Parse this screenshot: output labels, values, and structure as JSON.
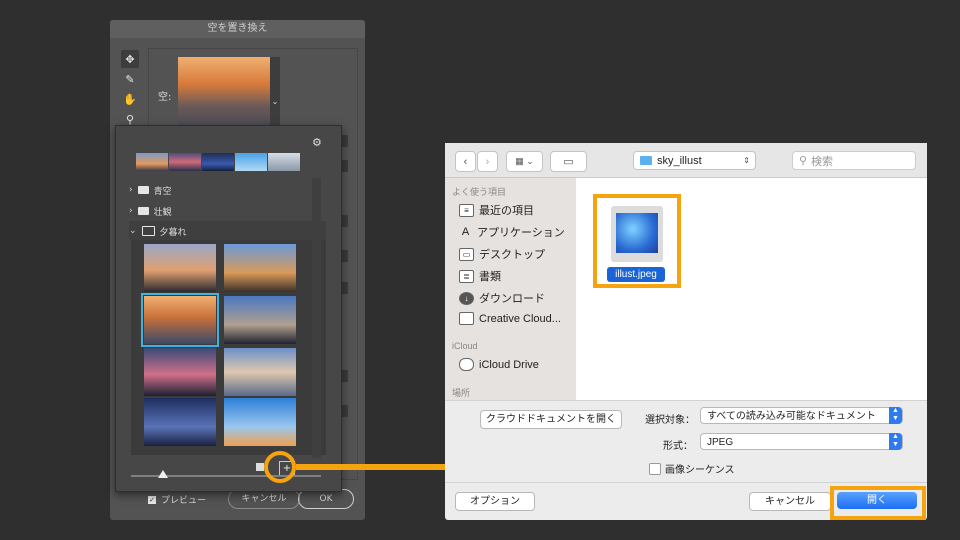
{
  "ps_dialog": {
    "title": "空を置き換え",
    "sky_label": "空:",
    "folders": [
      {
        "label": "青空",
        "expanded": false
      },
      {
        "label": "壮観",
        "expanded": false
      },
      {
        "label": "夕暮れ",
        "expanded": true
      }
    ],
    "preview_label": "プレビュー",
    "preview_checked": true,
    "cancel_label": "キャンセル",
    "ok_label": "OK",
    "new_preset_glyph": "+"
  },
  "mac_dialog": {
    "location": "sky_illust",
    "search_placeholder": "検索",
    "sidebar": {
      "favorites_header": "よく使う項目",
      "favorites": [
        "最近の項目",
        "アプリケーション",
        "デスクトップ",
        "書類",
        "ダウンロード",
        "Creative Cloud..."
      ],
      "icloud_header": "iCloud",
      "icloud_items": [
        "iCloud Drive"
      ],
      "places_header": "場所"
    },
    "file": {
      "name": "illust.jpeg"
    },
    "open_cloud_doc_label": "クラウドドキュメントを開く",
    "enable_label": "選択対象：",
    "enable_value": "すべての読み込み可能なドキュメント",
    "format_label": "形式：",
    "format_value": "JPEG",
    "image_sequence_label": "画像シーケンス",
    "image_sequence_checked": false,
    "options_label": "オプション",
    "cancel_label": "キャンセル",
    "open_label": "開く"
  },
  "colors": {
    "highlight": "#f5a40f",
    "selection_blue": "#1b64d6"
  }
}
